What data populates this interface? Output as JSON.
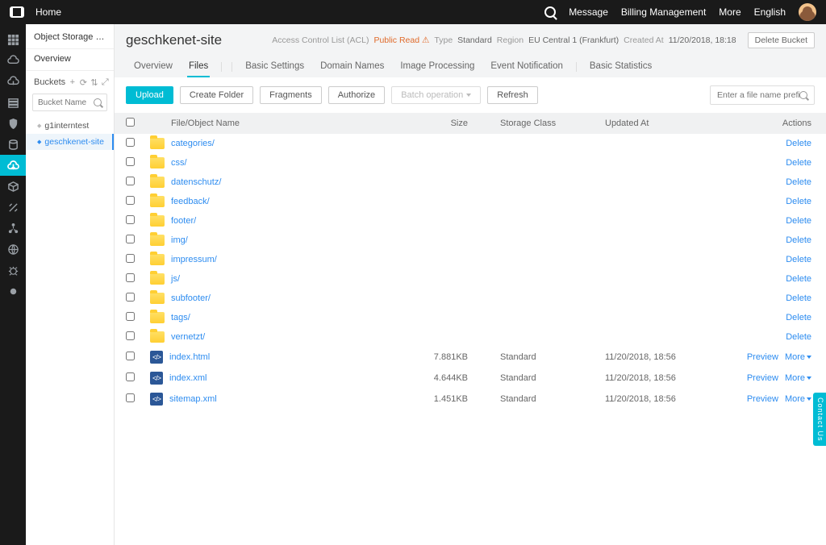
{
  "topbar": {
    "home": "Home",
    "links": [
      "Message",
      "Billing Management",
      "More",
      "English"
    ]
  },
  "sidebar": {
    "title": "Object Storage Ser...",
    "overview": "Overview",
    "buckets_label": "Buckets",
    "search_placeholder": "Bucket Name",
    "buckets": [
      {
        "name": "g1interntest",
        "active": false
      },
      {
        "name": "geschkenet-site",
        "active": true
      }
    ]
  },
  "header": {
    "bucket_name": "geschkenet-site",
    "acl_label": "Access Control List (ACL)",
    "acl_value": "Public Read",
    "type_label": "Type",
    "type_value": "Standard",
    "region_label": "Region",
    "region_value": "EU Central 1 (Frankfurt)",
    "created_label": "Created At",
    "created_value": "11/20/2018, 18:18",
    "delete_btn": "Delete Bucket",
    "tabs": [
      "Overview",
      "Files",
      "Basic Settings",
      "Domain Names",
      "Image Processing",
      "Event Notification",
      "Basic Statistics"
    ],
    "active_tab": 1
  },
  "toolbar": {
    "upload": "Upload",
    "create_folder": "Create Folder",
    "fragments": "Fragments",
    "authorize": "Authorize",
    "batch": "Batch operation",
    "refresh": "Refresh",
    "filter_placeholder": "Enter a file name prefix"
  },
  "columns": {
    "name": "File/Object Name",
    "size": "Size",
    "storage_class": "Storage Class",
    "updated": "Updated At",
    "actions": "Actions"
  },
  "actions": {
    "delete": "Delete",
    "preview": "Preview",
    "more": "More"
  },
  "items": [
    {
      "type": "folder",
      "name": "categories/"
    },
    {
      "type": "folder",
      "name": "css/"
    },
    {
      "type": "folder",
      "name": "datenschutz/"
    },
    {
      "type": "folder",
      "name": "feedback/"
    },
    {
      "type": "folder",
      "name": "footer/"
    },
    {
      "type": "folder",
      "name": "img/"
    },
    {
      "type": "folder",
      "name": "impressum/"
    },
    {
      "type": "folder",
      "name": "js/"
    },
    {
      "type": "folder",
      "name": "subfooter/"
    },
    {
      "type": "folder",
      "name": "tags/"
    },
    {
      "type": "folder",
      "name": "vernetzt/"
    },
    {
      "type": "file",
      "name": "index.html",
      "size": "7.881KB",
      "sc": "Standard",
      "updated": "11/20/2018, 18:56"
    },
    {
      "type": "file",
      "name": "index.xml",
      "size": "4.644KB",
      "sc": "Standard",
      "updated": "11/20/2018, 18:56"
    },
    {
      "type": "file",
      "name": "sitemap.xml",
      "size": "1.451KB",
      "sc": "Standard",
      "updated": "11/20/2018, 18:56"
    }
  ],
  "contact_us": "Contact Us"
}
